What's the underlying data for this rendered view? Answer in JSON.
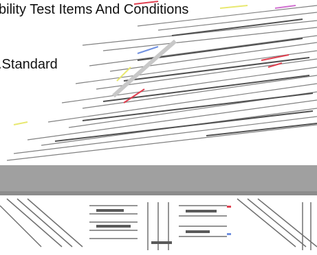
{
  "heading": {
    "title": "bility Test Items And Conditions",
    "standard": ".Standard"
  },
  "colors": {
    "background": "#ffffff",
    "artifact_gray": "#808080",
    "artifact_dark": "#505050",
    "band_gray": "#a0a0a0",
    "accent_red": "#e04050",
    "accent_pink": "#d070d0",
    "accent_yellow": "#e8e870",
    "accent_blue": "#7090e0"
  }
}
